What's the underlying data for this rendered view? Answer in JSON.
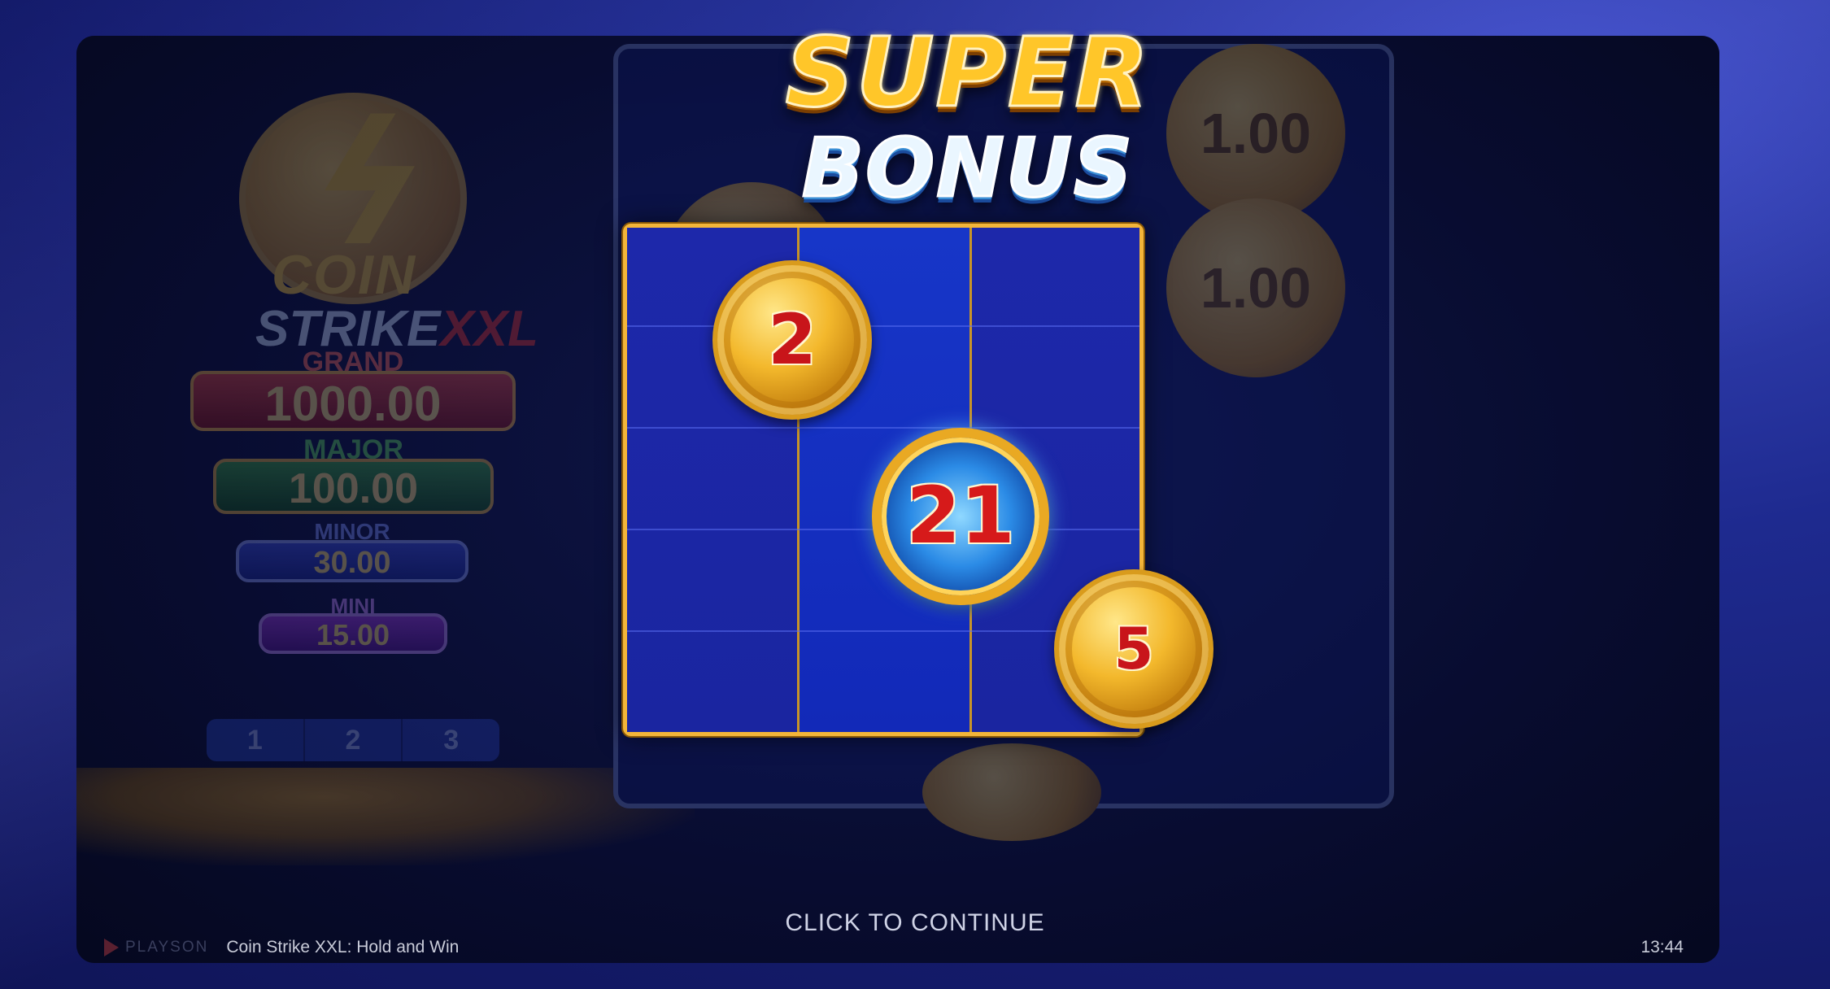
{
  "background_game": {
    "logo": {
      "word_coin": "COIN",
      "word_strike": "STRIKE",
      "word_xxl": "XXL"
    },
    "jackpots": [
      {
        "label": "GRAND",
        "value": "1000.00",
        "color": "#c9261c"
      },
      {
        "label": "MAJOR",
        "value": "100.00",
        "color": "#2a8a28"
      },
      {
        "label": "MINOR",
        "value": "30.00",
        "color": "#2a3fcf"
      },
      {
        "label": "MINI",
        "value": "15.00",
        "color": "#7e25c2"
      }
    ],
    "tabs": [
      "1",
      "2",
      "3"
    ],
    "reel_coins": [
      "1.00",
      "1.00"
    ]
  },
  "title": {
    "line1": "SUPER",
    "line2": "BONUS"
  },
  "bonus_grid": {
    "coins": [
      {
        "value": "2",
        "type": "gold"
      },
      {
        "value": "21",
        "type": "blue-lightning"
      },
      {
        "value": "5",
        "type": "gold"
      }
    ],
    "frame_color": "#f3b539"
  },
  "prompt": "CLICK TO CONTINUE",
  "footer": {
    "brand": "PLAYSON",
    "game_name": "Coin Strike XXL: Hold and Win",
    "time": "13:44"
  }
}
